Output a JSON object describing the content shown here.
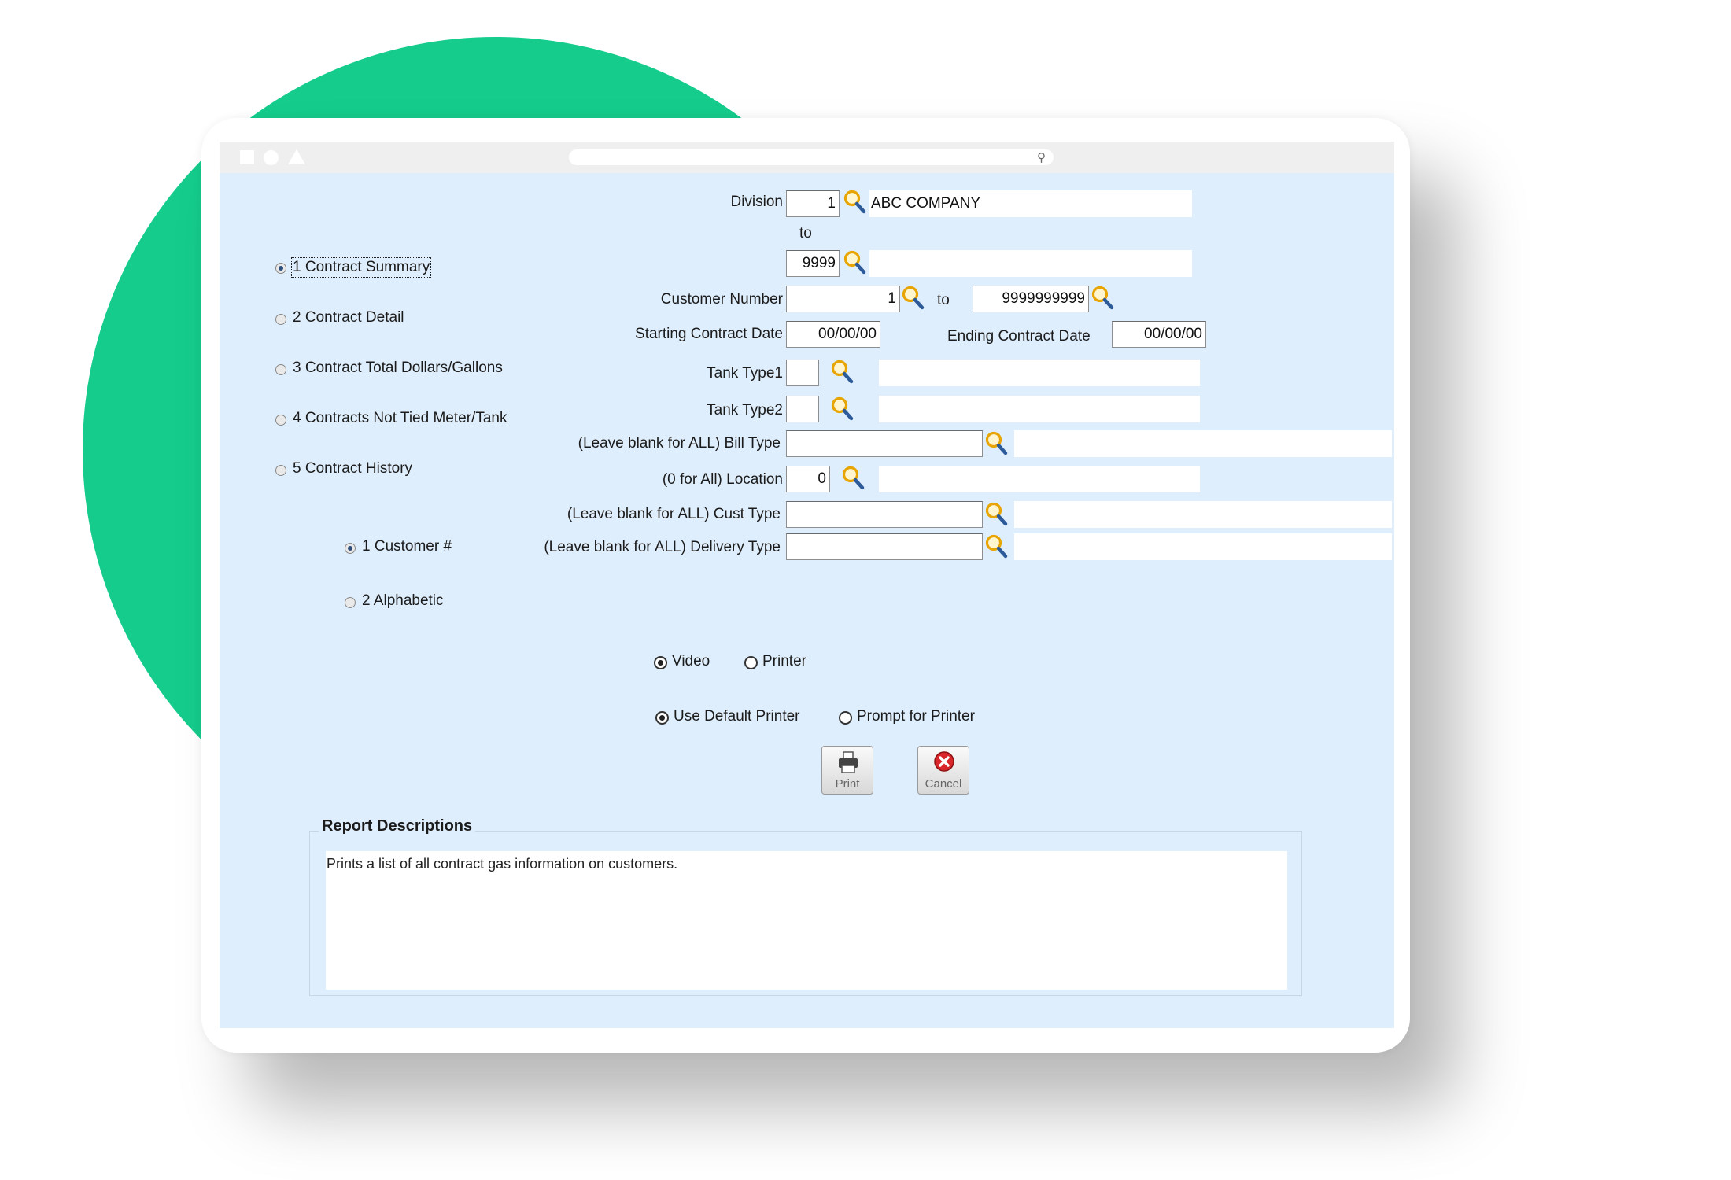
{
  "form": {
    "division_label": "Division",
    "division_from": "1",
    "division_name": "ABC COMPANY",
    "to_label": "to",
    "division_to": "9999",
    "customer_number_label": "Customer Number",
    "customer_from": "1",
    "customer_to_label": "to",
    "customer_to": "9999999999",
    "starting_contract_date_label": "Starting Contract Date",
    "starting_contract_date": "00/00/00",
    "ending_contract_date_label": "Ending Contract Date",
    "ending_contract_date": "00/00/00",
    "tank_type1_label": "Tank Type1",
    "tank_type1": "",
    "tank_type2_label": "Tank Type2",
    "tank_type2": "",
    "bill_type_label": "(Leave blank for ALL) Bill Type",
    "bill_type": "",
    "location_label": "(0 for All) Location",
    "location": "0",
    "cust_type_label": "(Leave blank for ALL) Cust Type",
    "cust_type": "",
    "delivery_type_label": "(Leave blank for ALL) Delivery Type",
    "delivery_type": ""
  },
  "report_options": [
    {
      "label": "1 Contract Summary",
      "selected": true
    },
    {
      "label": "2 Contract Detail",
      "selected": false
    },
    {
      "label": "3 Contract Total Dollars/Gallons",
      "selected": false
    },
    {
      "label": "4 Contracts Not Tied Meter/Tank",
      "selected": false
    },
    {
      "label": "5 Contract History",
      "selected": false
    }
  ],
  "sort_options": [
    {
      "label": "1 Customer #",
      "selected": true
    },
    {
      "label": "2  Alphabetic",
      "selected": false
    }
  ],
  "output": {
    "video_label": "Video",
    "printer_label": "Printer",
    "use_default_printer_label": "Use Default Printer",
    "prompt_for_printer_label": "Prompt for Printer"
  },
  "buttons": {
    "print_label": "Print",
    "cancel_label": "Cancel"
  },
  "report_descriptions": {
    "title": "Report Descriptions",
    "text": "Prints a list of all contract gas information on customers."
  },
  "colors": {
    "accent_green": "#15cc8c",
    "screen_background": "#dfeefc"
  }
}
